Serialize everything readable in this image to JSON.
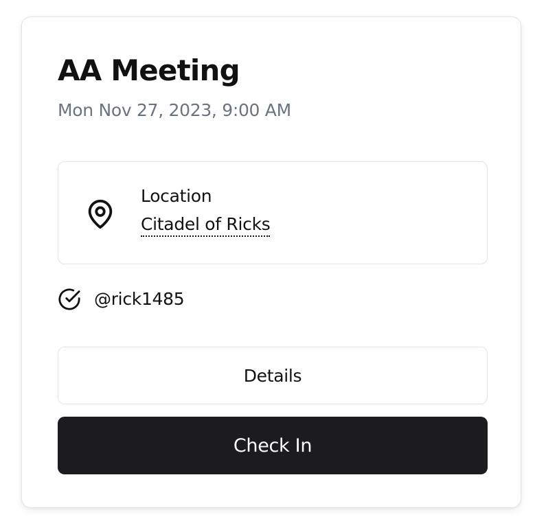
{
  "event": {
    "title": "AA Meeting",
    "datetime": "Mon Nov 27, 2023, 9:00 AM"
  },
  "location": {
    "label": "Location",
    "value": "Citadel of Ricks",
    "icon": "map-pin-icon"
  },
  "checked_in": {
    "icon": "circle-check-icon",
    "username": "@rick1485"
  },
  "actions": {
    "details_label": "Details",
    "checkin_label": "Check In"
  },
  "colors": {
    "primary_button_bg": "#1c1c1e",
    "muted_text": "#6b7280",
    "border": "#e4e4e7"
  }
}
